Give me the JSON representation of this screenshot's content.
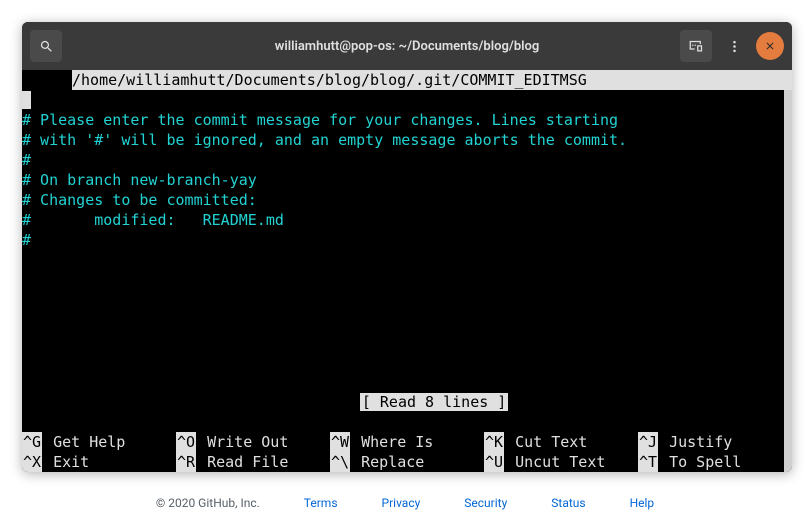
{
  "titlebar": {
    "title": "williamhutt@pop-os: ~/Documents/blog/blog"
  },
  "nano": {
    "header_path": "/home/williamhutt/Documents/blog/blog/.git/COMMIT_EDITMSG",
    "lines": [
      "",
      "# Please enter the commit message for your changes. Lines starting",
      "# with '#' will be ignored, and an empty message aborts the commit.",
      "#",
      "# On branch new-branch-yay",
      "# Changes to be committed:",
      "#       modified:   README.md",
      "#"
    ],
    "status": "[ Read 8 lines ]",
    "shortcuts": [
      {
        "key": "^G",
        "label": "Get Help"
      },
      {
        "key": "^O",
        "label": "Write Out"
      },
      {
        "key": "^W",
        "label": "Where Is"
      },
      {
        "key": "^K",
        "label": "Cut Text"
      },
      {
        "key": "^J",
        "label": "Justify"
      },
      {
        "key": "^X",
        "label": "Exit"
      },
      {
        "key": "^R",
        "label": "Read File"
      },
      {
        "key": "^\\",
        "label": "Replace"
      },
      {
        "key": "^U",
        "label": "Uncut Text"
      },
      {
        "key": "^T",
        "label": "To Spell"
      }
    ]
  },
  "footer": {
    "copyright": "© 2020 GitHub, Inc.",
    "links": [
      "Terms",
      "Privacy",
      "Security",
      "Status",
      "Help"
    ]
  }
}
